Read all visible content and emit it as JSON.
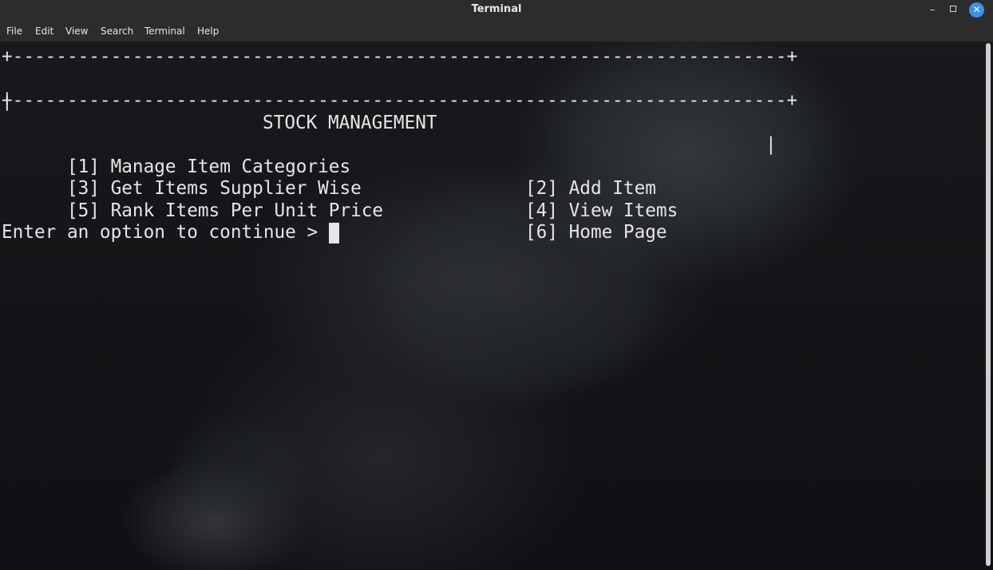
{
  "window": {
    "title": "Terminal"
  },
  "menu": [
    "File",
    "Edit",
    "View",
    "Search",
    "Terminal",
    "Help"
  ],
  "terminal": {
    "border_top": "+-----------------------------------------------------------------------+",
    "header_left": "|",
    "header_title": "STOCK MANAGEMENT",
    "header_right": "|",
    "border_bottom": "+-----------------------------------------------------------------------+",
    "options": [
      {
        "left": "[1] Manage Item Categories",
        "right": "[2] Add Item"
      },
      {
        "left": "[3] Get Items Supplier Wise",
        "right": "[4] View Items"
      },
      {
        "left": "[5] Rank Items Per Unit Price",
        "right": "[6] Home Page"
      }
    ],
    "prompt": "Enter an option to continue > "
  },
  "colors": {
    "accent": "#3d8fe6",
    "terminal_text": "#e6e6e6",
    "chrome": "#2c2c2c"
  }
}
